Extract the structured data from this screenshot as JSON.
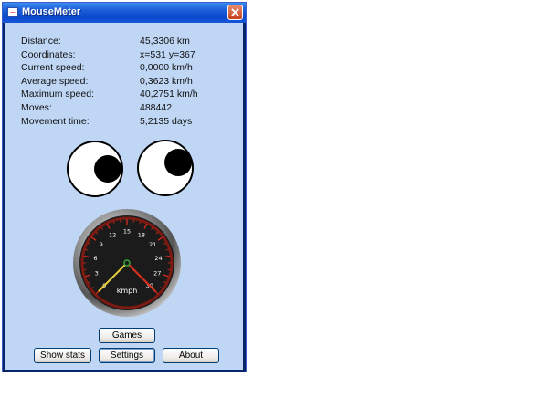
{
  "window": {
    "title": "MouseMeter",
    "icon": "mousemeter-app-icon",
    "close_icon": "close-x-icon"
  },
  "stats": [
    {
      "label": "Distance:",
      "value": "45,3306 km"
    },
    {
      "label": "Coordinates:",
      "value": "x=531 y=367"
    },
    {
      "label": "Current speed:",
      "value": "0,0000 km/h"
    },
    {
      "label": "Average speed:",
      "value": "0,3623 km/h"
    },
    {
      "label": "Maximum speed:",
      "value": "40,2751 km/h"
    },
    {
      "label": "Moves:",
      "value": "488442"
    },
    {
      "label": "Movement time:",
      "value": "5,2135 days"
    }
  ],
  "gauge": {
    "unit": "kmph",
    "ticks": [
      "0",
      "3",
      "6",
      "9",
      "12",
      "15",
      "18",
      "21",
      "24",
      "27",
      "30"
    ],
    "current_speed": 0,
    "max_speed_marker": 30
  },
  "buttons": {
    "games": "Games",
    "show_stats": "Show stats",
    "settings": "Settings",
    "about": "About"
  },
  "colors": {
    "title_bar": "#1d5fd8",
    "client_bg": "#bfd6f5",
    "gauge_face": "#111111",
    "gauge_tick": "#cc2a1a",
    "needle_max": "#e03020",
    "needle_current": "#e8d23a"
  }
}
